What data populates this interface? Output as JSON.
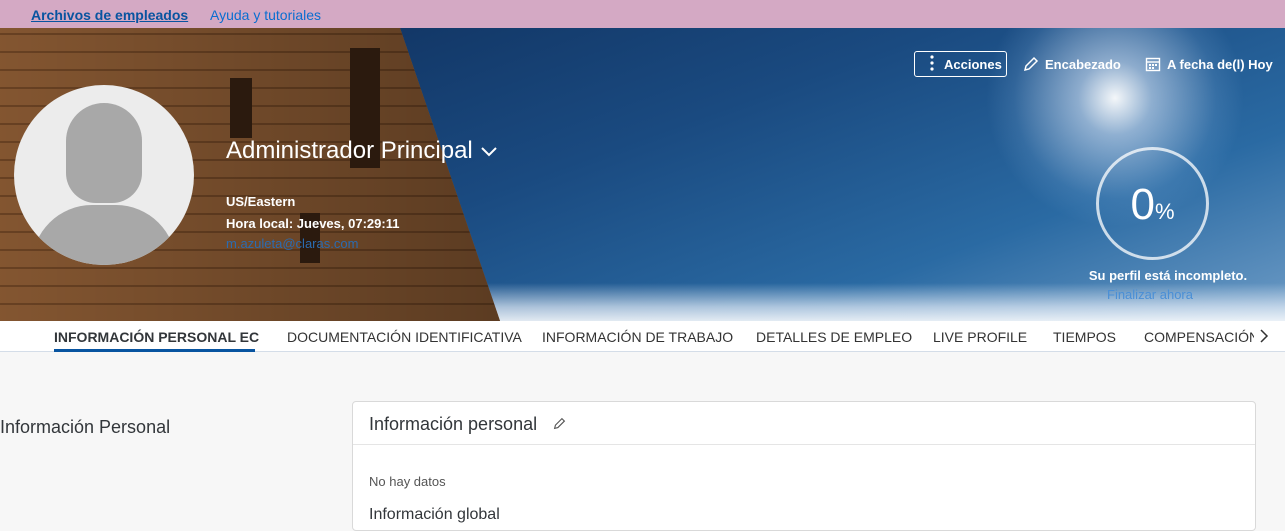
{
  "topnav": {
    "employee_files": "Archivos de empleados",
    "help": "Ayuda y tutoriales"
  },
  "header": {
    "name": "Administrador Principal",
    "timezone": "US/Eastern",
    "local_time": "Hora local: Jueves, 07:29:11",
    "email": "m.azuleta@claras.com",
    "actions_label": "Acciones",
    "header_label": "Encabezado",
    "as_of_label": "A fecha de(l) Hoy",
    "profile_completion_percent": 0,
    "profile_completion_number": "0",
    "profile_completion_unit": "%",
    "incomplete_text": "Su perfil está incompleto.",
    "finish_link": "Finalizar ahora"
  },
  "tabs": [
    {
      "label": "INFORMACIÓN PERSONAL EC",
      "active": true
    },
    {
      "label": "DOCUMENTACIÓN IDENTIFICATIVA",
      "active": false
    },
    {
      "label": "INFORMACIÓN DE TRABAJO",
      "active": false
    },
    {
      "label": "DETALLES DE EMPLEO",
      "active": false
    },
    {
      "label": "LIVE PROFILE",
      "active": false
    },
    {
      "label": "TIEMPOS",
      "active": false
    },
    {
      "label": "COMPENSACIÓN",
      "active": false
    }
  ],
  "main": {
    "section_label": "Información Personal",
    "card_title": "Información personal",
    "no_data": "No hay datos",
    "subheading": "Información global"
  },
  "colors": {
    "topbar_bg": "#d4a9c4",
    "link": "#0a6ed1",
    "tab_active_underline": "#0854a0"
  },
  "icons": {
    "actions": "vertical-dots-icon",
    "header": "pencil-icon",
    "as_of": "calendar-icon",
    "tabs_next": "chevron-right-icon",
    "name_menu": "chevron-down-icon",
    "card_edit": "pencil-icon"
  }
}
